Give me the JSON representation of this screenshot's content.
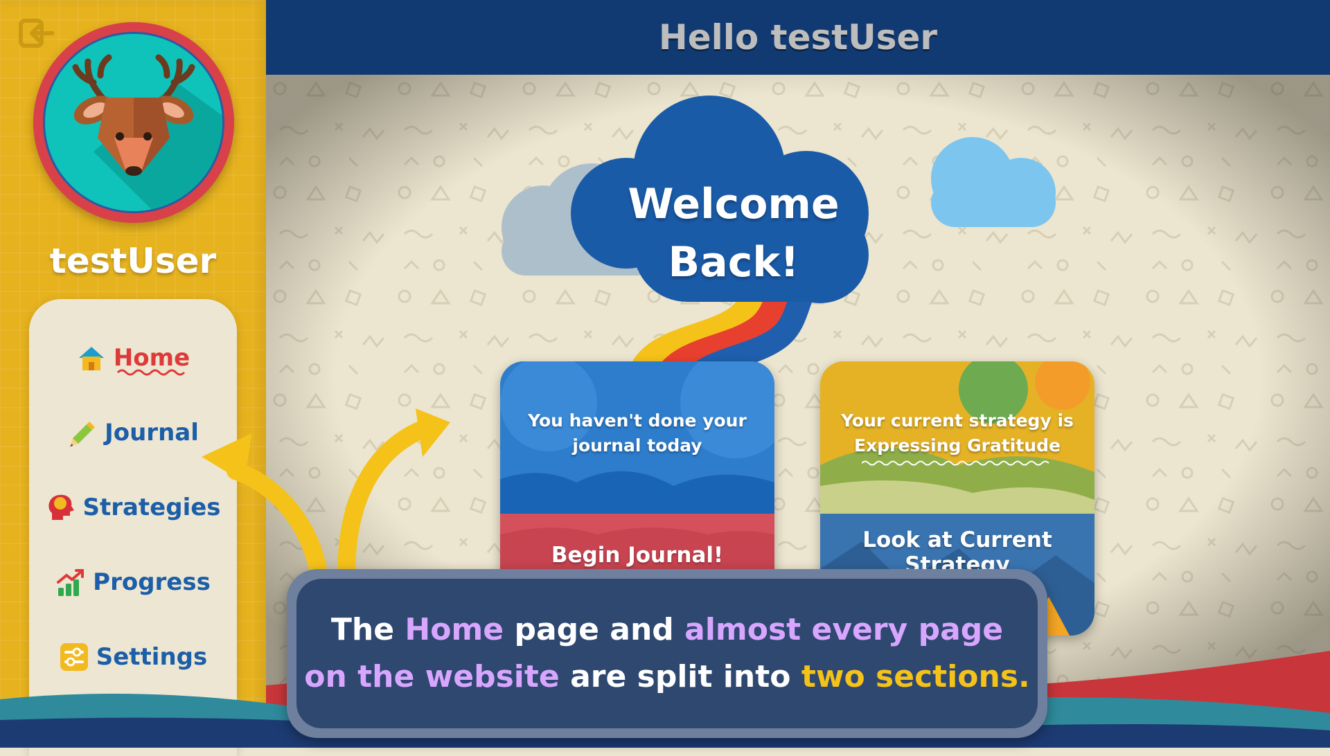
{
  "sidebar": {
    "username": "testUser",
    "logout_icon": "logout-icon",
    "avatar_icon": "deer-avatar",
    "nav": [
      {
        "label": "Home",
        "icon": "house-icon",
        "active": true
      },
      {
        "label": "Journal",
        "icon": "pencil-icon",
        "active": false
      },
      {
        "label": "Strategies",
        "icon": "head-brain-icon",
        "active": false
      },
      {
        "label": "Progress",
        "icon": "bar-chart-icon",
        "active": false
      },
      {
        "label": "Settings",
        "icon": "sliders-icon",
        "active": false
      }
    ]
  },
  "header": {
    "title": "Hello testUser"
  },
  "main": {
    "welcome_line1": "Welcome",
    "welcome_line2": "Back!",
    "journal_card": {
      "message_line1": "You haven't done your",
      "message_line2": "journal today",
      "button": "Begin Journal!"
    },
    "strategy_card": {
      "message_line1": "Your current strategy is",
      "strategy_name": "Expressing Gratitude",
      "button": "Look at Current",
      "button_cut": "Strategy"
    }
  },
  "tooltip": {
    "part1": "The ",
    "part2": "Home",
    "part3": " page and ",
    "part4": "almost every page",
    "part5": "on the website",
    "part6": " are split into ",
    "part7": "two sections."
  },
  "colors": {
    "sidebar_yellow": "#e6b21e",
    "header_navy": "#123a72",
    "nav_blue": "#1c5ea8",
    "active_red": "#de3a3a",
    "highlight_purple": "#d9a6ff",
    "highlight_yellow": "#f5c21a"
  }
}
